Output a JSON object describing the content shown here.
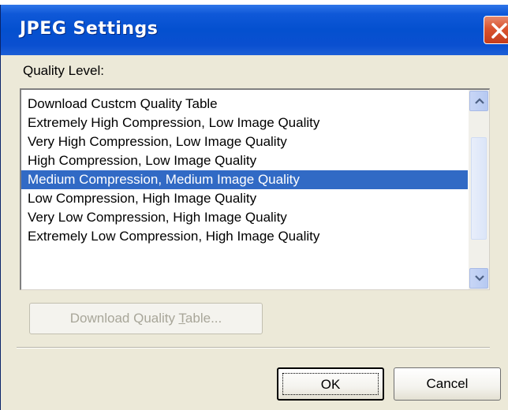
{
  "window": {
    "title": "JPEG Settings"
  },
  "quality": {
    "label": "Quality Level:",
    "items": [
      "Download Custcm Quality Table",
      "Extremely High Compression, Low Image Quality",
      "Very High Compression, Low Image Quality",
      "High Compression, Low Image Quality",
      "Medium Compression, Medium Image Quality",
      "Low Compression, High Image Quality",
      "Very Low Compression, High Image Quality",
      "Extremely Low Compression, High Image Quality"
    ],
    "selected_index": 4
  },
  "buttons": {
    "download_prefix": "Download Quality ",
    "download_accel": "T",
    "download_suffix": "able...",
    "ok": "OK",
    "cancel": "Cancel"
  },
  "colors": {
    "titlebar": "#0450cf",
    "selection": "#316ac5",
    "close": "#d9532f"
  }
}
